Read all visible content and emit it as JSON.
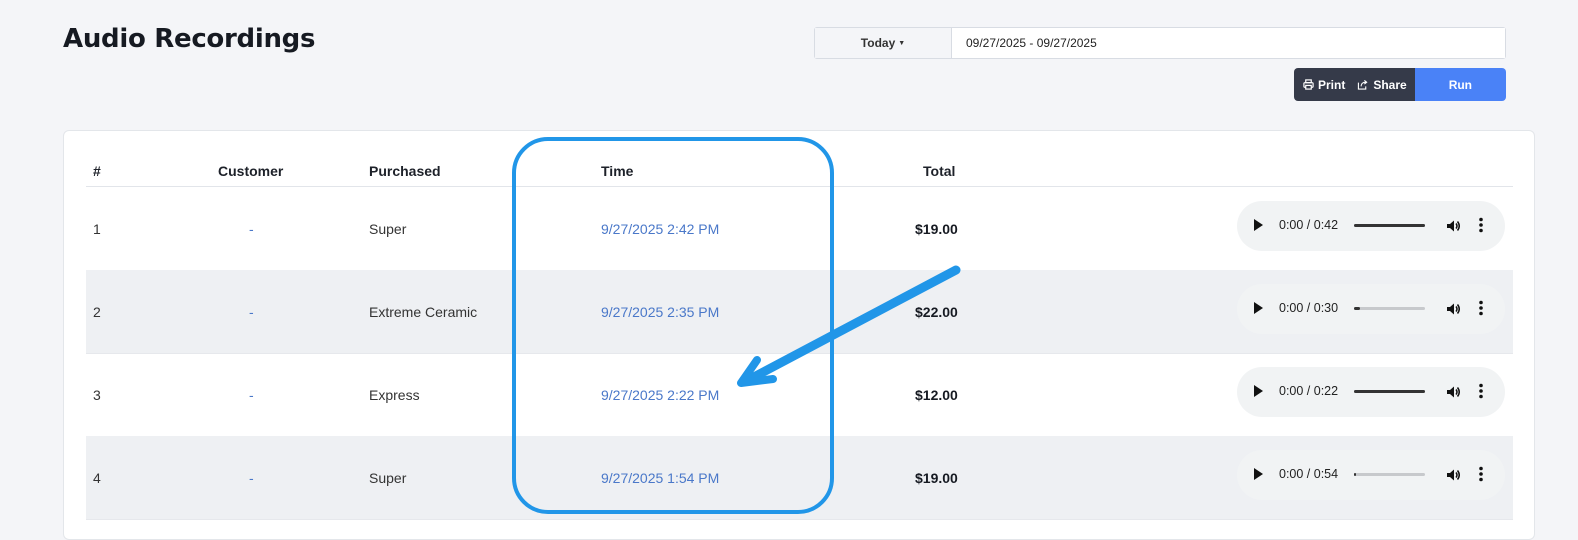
{
  "page": {
    "title": "Audio Recordings"
  },
  "filters": {
    "range_label": "Today",
    "date_range": "09/27/2025 - 09/27/2025"
  },
  "actions": {
    "print": "Print",
    "share": "Share",
    "run": "Run"
  },
  "table": {
    "headers": {
      "num": "#",
      "customer": "Customer",
      "purchased": "Purchased",
      "time": "Time",
      "total": "Total"
    },
    "rows": [
      {
        "num": "1",
        "customer": "-",
        "purchased": "Super",
        "time": "9/27/2025 2:42 PM",
        "total": "$19.00",
        "audio": "0:00 / 0:42",
        "progress": 1.0
      },
      {
        "num": "2",
        "customer": "-",
        "purchased": "Extreme Ceramic",
        "time": "9/27/2025 2:35 PM",
        "total": "$22.00",
        "audio": "0:00 / 0:30",
        "progress": 0.08
      },
      {
        "num": "3",
        "customer": "-",
        "purchased": "Express",
        "time": "9/27/2025 2:22 PM",
        "total": "$12.00",
        "audio": "0:00 / 0:22",
        "progress": 1.0
      },
      {
        "num": "4",
        "customer": "-",
        "purchased": "Super",
        "time": "9/27/2025 1:54 PM",
        "total": "$19.00",
        "audio": "0:00 / 0:54",
        "progress": 0.03
      }
    ]
  },
  "colors": {
    "accent_blue": "#4a82f7",
    "dark_button": "#353a49",
    "link": "#4a78c9",
    "annotation": "#2196e8"
  }
}
